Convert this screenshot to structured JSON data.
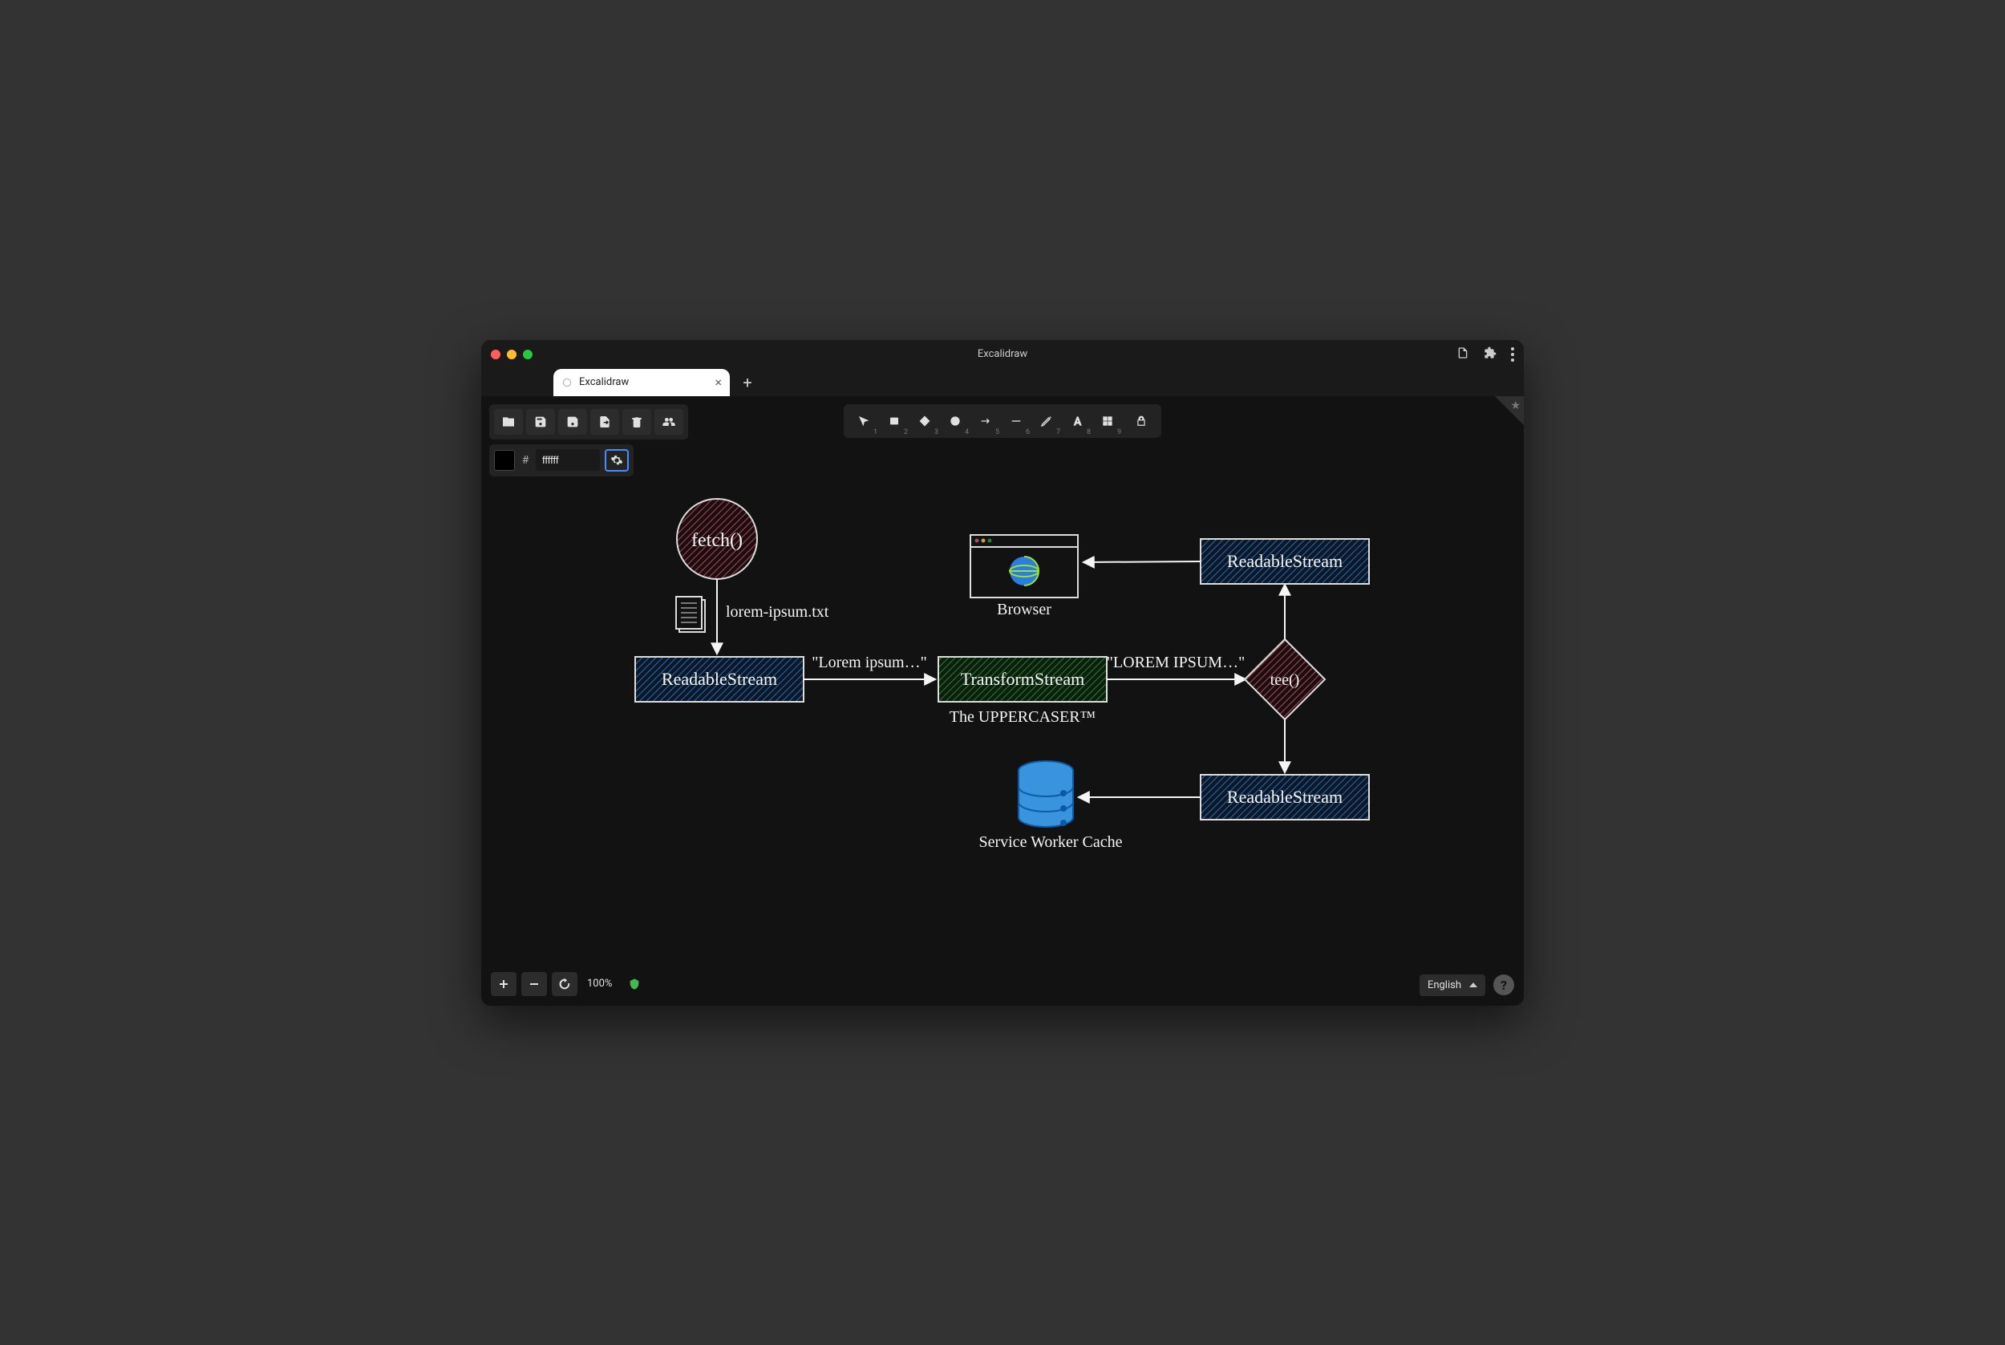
{
  "window": {
    "title": "Excalidraw"
  },
  "tab": {
    "label": "Excalidraw"
  },
  "color": {
    "hash": "#",
    "value": "ffffff"
  },
  "zoom": {
    "label": "100%"
  },
  "language": {
    "label": "English"
  },
  "tools": {
    "nums": [
      "1",
      "2",
      "3",
      "4",
      "5",
      "6",
      "7",
      "8",
      "9"
    ]
  },
  "diagram": {
    "fetch": "fetch()",
    "lorem_file": "lorem-ipsum.txt",
    "readable1": "ReadableStream",
    "lorem_lower": "\"Lorem ipsum…\"",
    "transform": "TransformStream",
    "uppercaser": "The UPPERCASER™",
    "lorem_upper": "\"LOREM IPSUM…\"",
    "tee": "tee()",
    "readable2": "ReadableStream",
    "browser": "Browser",
    "readable3": "ReadableStream",
    "swcache": "Service Worker Cache"
  }
}
